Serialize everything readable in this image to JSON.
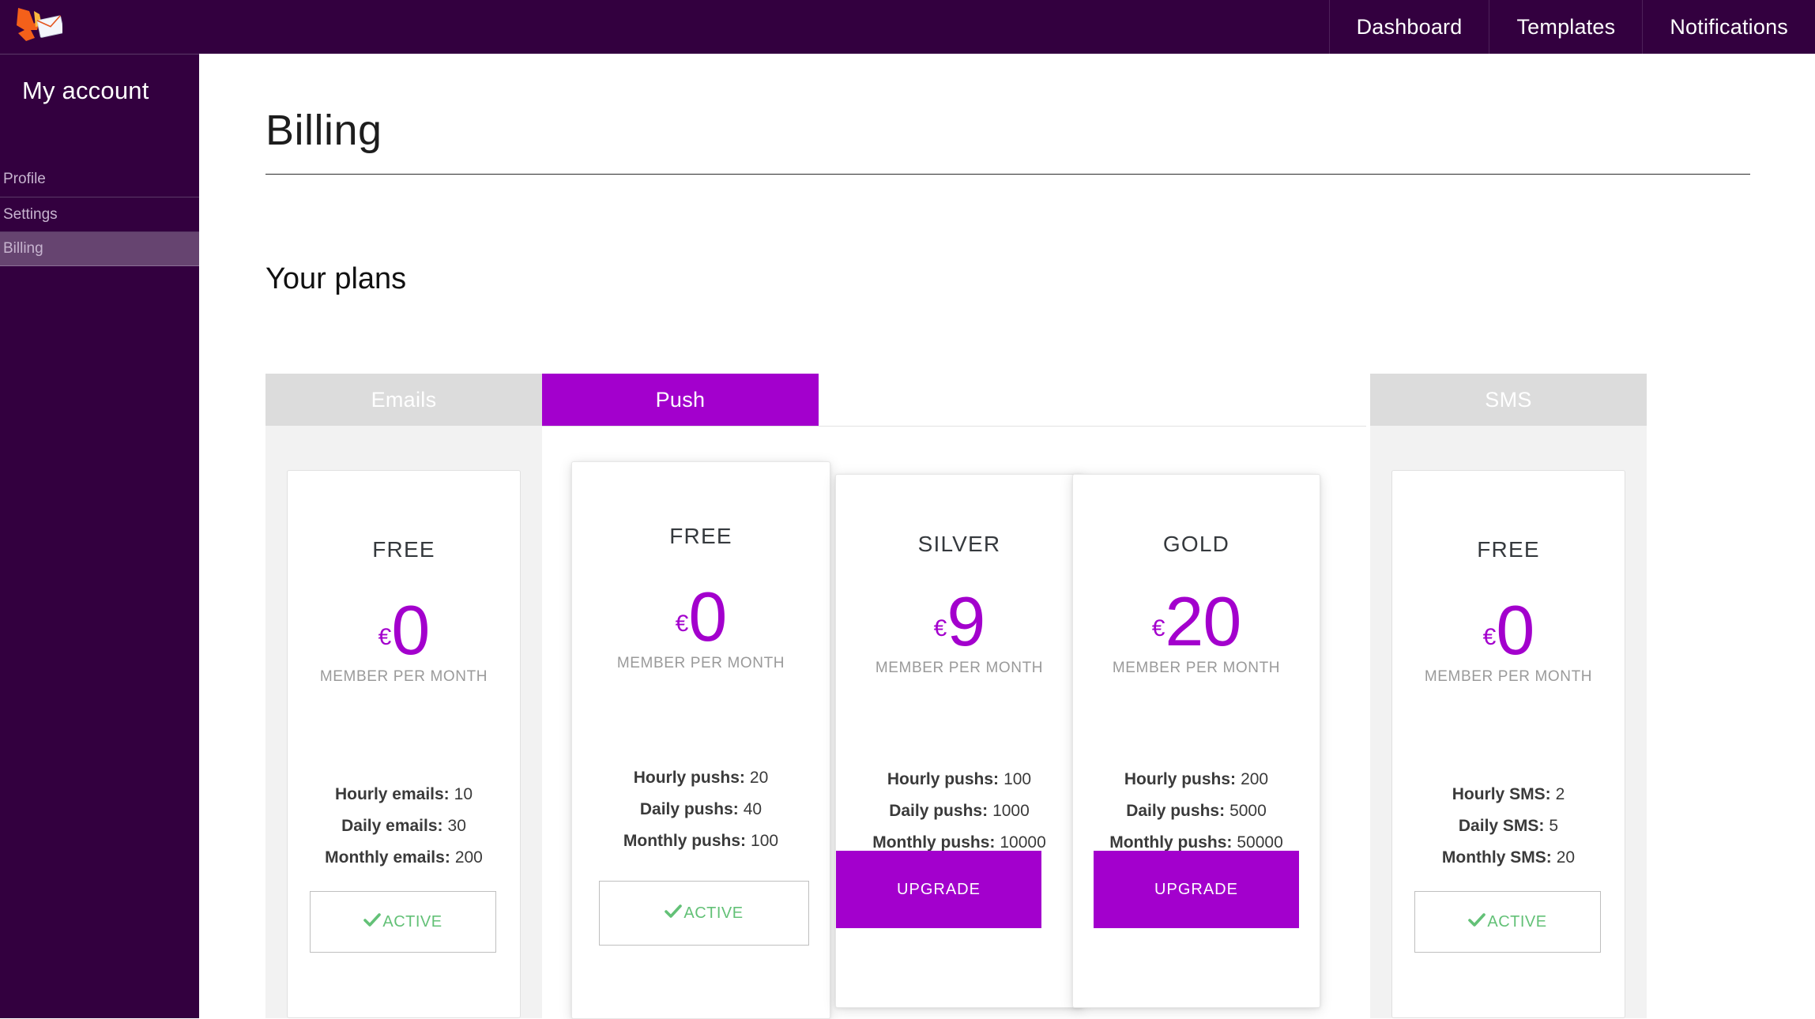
{
  "topnav": {
    "logo_icon": "phoenix-envelope-logo",
    "items": [
      {
        "label": "Dashboard"
      },
      {
        "label": "Templates"
      },
      {
        "label": "Notifications"
      }
    ]
  },
  "sidebar": {
    "title": "My account",
    "items": [
      {
        "label": "Profile",
        "active": false
      },
      {
        "label": "Settings",
        "active": false
      },
      {
        "label": "Billing",
        "active": true
      }
    ]
  },
  "main": {
    "page_title": "Billing",
    "section_title": "Your plans"
  },
  "colors": {
    "brand_purple": "#a300cd",
    "nav_purple": "#33003f",
    "sidebar_active": "#664470",
    "active_green": "#63c177",
    "tab_inactive": "#dcdcdc"
  },
  "channels": [
    {
      "id": "emails",
      "tab_label": "Emails",
      "selected": false,
      "plans": [
        {
          "name": "FREE",
          "currency": "€",
          "amount": "0",
          "period": "MEMBER PER MONTH",
          "features": [
            {
              "label": "Hourly emails:",
              "value": "10"
            },
            {
              "label": "Daily emails:",
              "value": "30"
            },
            {
              "label": "Monthly emails:",
              "value": "200"
            }
          ],
          "cta": {
            "type": "active",
            "label": "ACTIVE",
            "icon": "check-icon"
          }
        }
      ]
    },
    {
      "id": "push",
      "tab_label": "Push",
      "selected": true,
      "plans": [
        {
          "name": "FREE",
          "currency": "€",
          "amount": "0",
          "period": "MEMBER PER MONTH",
          "features": [
            {
              "label": "Hourly pushs:",
              "value": "20"
            },
            {
              "label": "Daily pushs:",
              "value": "40"
            },
            {
              "label": "Monthly pushs:",
              "value": "100"
            }
          ],
          "cta": {
            "type": "active",
            "label": "ACTIVE",
            "icon": "check-icon"
          }
        },
        {
          "name": "SILVER",
          "currency": "€",
          "amount": "9",
          "period": "MEMBER PER MONTH",
          "features": [
            {
              "label": "Hourly pushs:",
              "value": "100"
            },
            {
              "label": "Daily pushs:",
              "value": "1000"
            },
            {
              "label": "Monthly pushs:",
              "value": "10000"
            }
          ],
          "cta": {
            "type": "upgrade",
            "label": "UPGRADE"
          }
        },
        {
          "name": "GOLD",
          "currency": "€",
          "amount": "20",
          "period": "MEMBER PER MONTH",
          "features": [
            {
              "label": "Hourly pushs:",
              "value": "200"
            },
            {
              "label": "Daily pushs:",
              "value": "5000"
            },
            {
              "label": "Monthly pushs:",
              "value": "50000"
            }
          ],
          "cta": {
            "type": "upgrade",
            "label": "UPGRADE"
          }
        }
      ]
    },
    {
      "id": "sms",
      "tab_label": "SMS",
      "selected": false,
      "plans": [
        {
          "name": "FREE",
          "currency": "€",
          "amount": "0",
          "period": "MEMBER PER MONTH",
          "features": [
            {
              "label": "Hourly SMS:",
              "value": "2"
            },
            {
              "label": "Daily SMS:",
              "value": "5"
            },
            {
              "label": "Monthly SMS:",
              "value": "20"
            }
          ],
          "cta": {
            "type": "active",
            "label": "ACTIVE",
            "icon": "check-icon"
          }
        }
      ]
    }
  ]
}
